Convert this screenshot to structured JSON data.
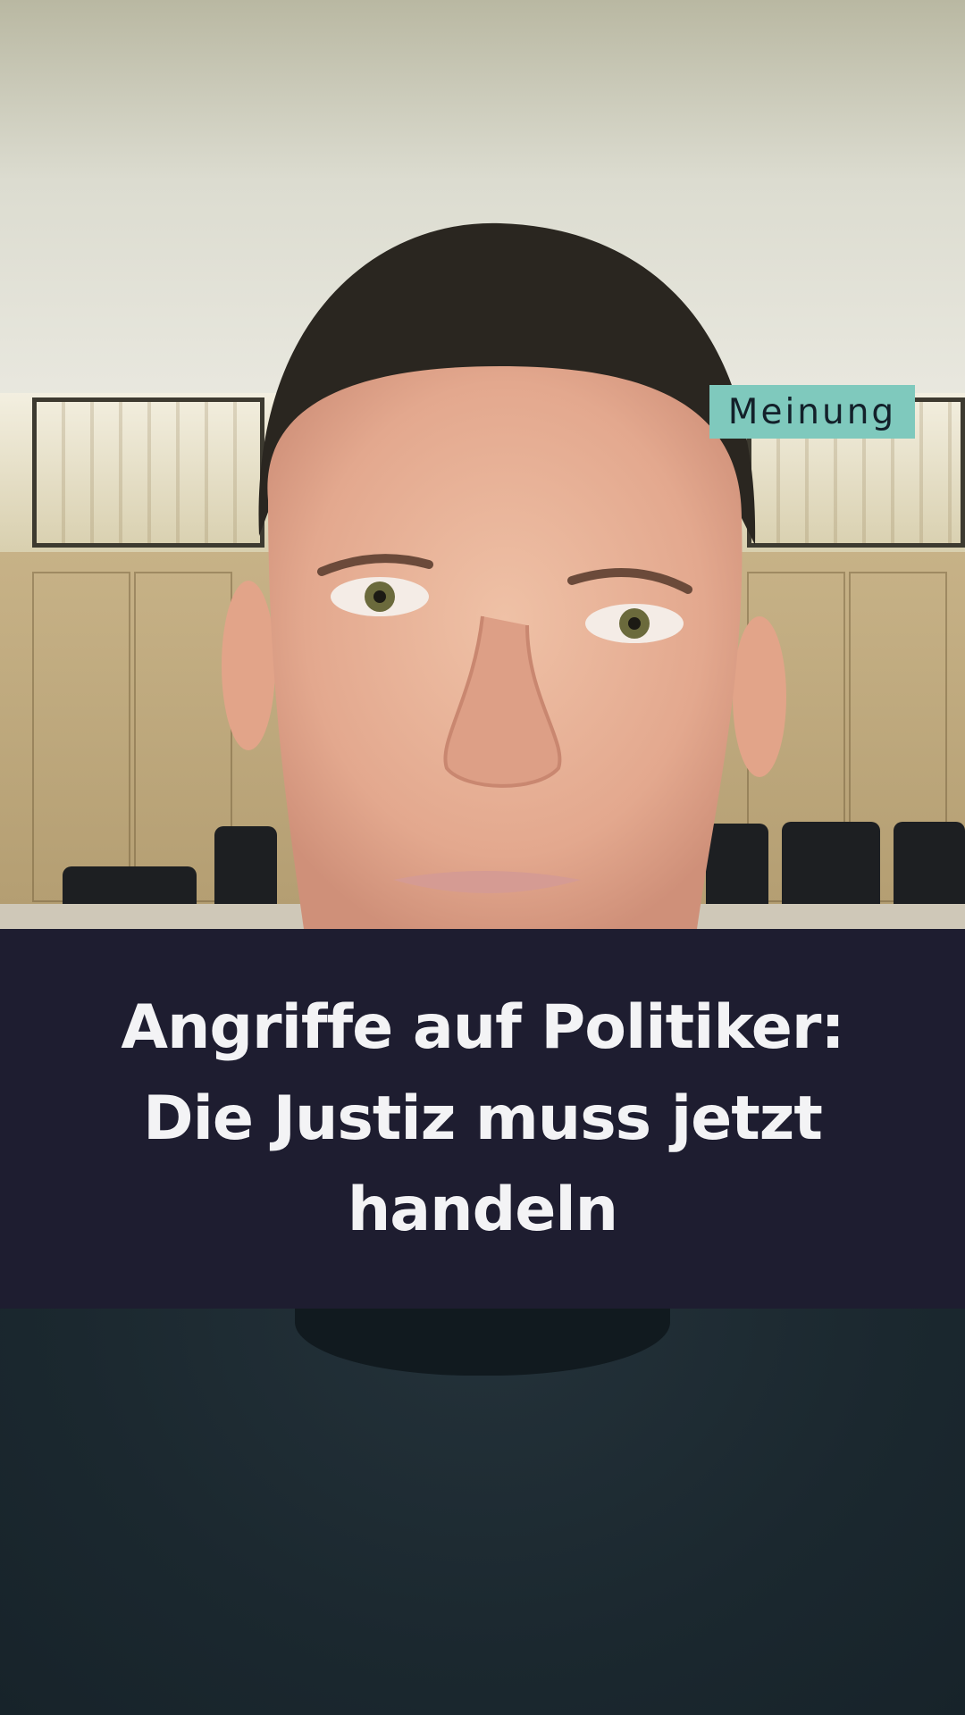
{
  "overlay": {
    "tag_label": "Meinung",
    "headline": "Angriffe auf Politiker: Die Justiz muss jetzt handeln"
  },
  "colors": {
    "tag_background": "#7fc9bd",
    "tag_text": "#13202a",
    "headline_background": "#1e1d30",
    "headline_text": "#f3f3f5"
  },
  "media": {
    "subject": "video-frame-person-portrait"
  }
}
